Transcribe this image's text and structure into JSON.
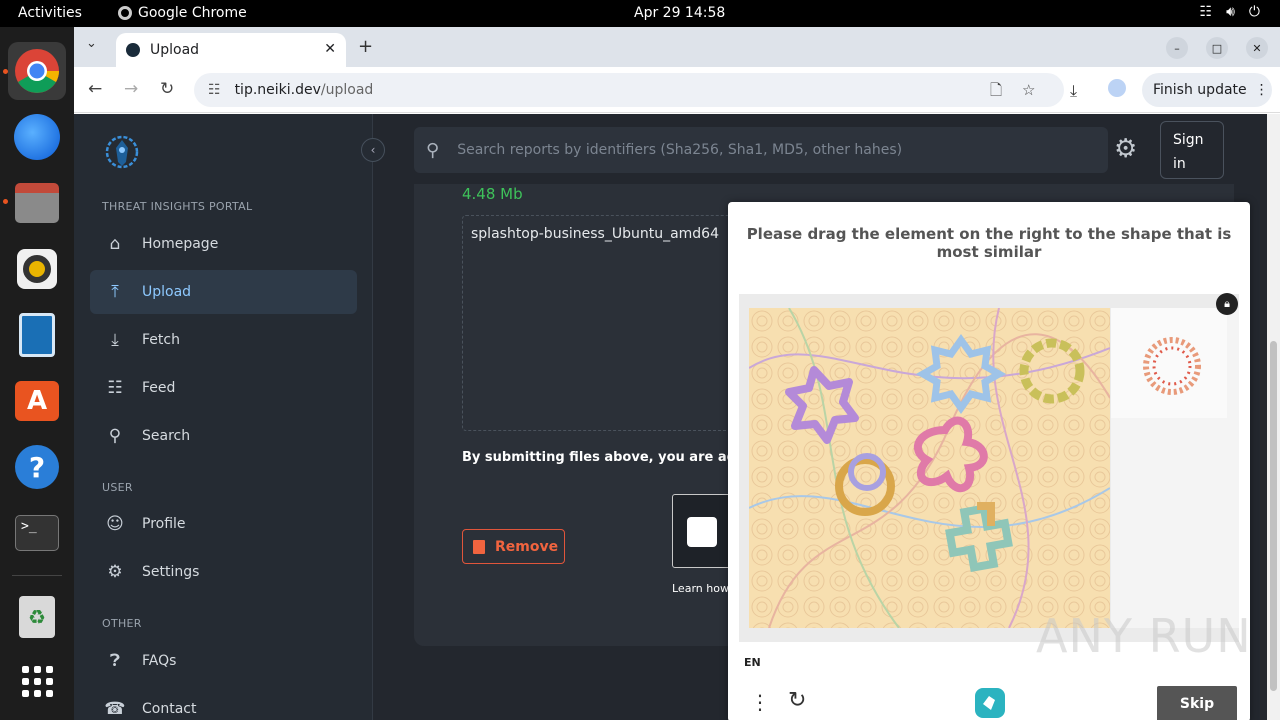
{
  "topbar": {
    "activities": "Activities",
    "app_name": "Google Chrome",
    "clock": "Apr 29  14:58"
  },
  "browser": {
    "tab_title": "Upload",
    "url_host": "tip.neiki.dev",
    "url_path": "/upload",
    "finish_update": "Finish update"
  },
  "sidebar": {
    "sections": [
      "THREAT INSIGHTS PORTAL",
      "USER",
      "OTHER"
    ],
    "items": [
      {
        "label": "Homepage",
        "icon": "home-icon"
      },
      {
        "label": "Upload",
        "icon": "upload-icon"
      },
      {
        "label": "Fetch",
        "icon": "fetch-icon"
      },
      {
        "label": "Feed",
        "icon": "feed-icon"
      },
      {
        "label": "Search",
        "icon": "search-icon"
      },
      {
        "label": "Profile",
        "icon": "profile-icon"
      },
      {
        "label": "Settings",
        "icon": "gear-icon"
      },
      {
        "label": "FAQs",
        "icon": "faq-icon"
      },
      {
        "label": "Contact",
        "icon": "contact-icon"
      }
    ]
  },
  "header": {
    "search_placeholder": "Search reports by identifiers (Sha256, Sha1, MD5, other hahes)",
    "sign_in": "Sign in"
  },
  "upload": {
    "file_size": "4.48 Mb",
    "file_name": "splashtop-business_Ubuntu_amd64",
    "agree_text": "By submitting files above, you are agreeing",
    "remove_label": "Remove",
    "learn_text": "Learn how"
  },
  "captcha": {
    "prompt": "Please drag the element on the right to the shape that is most similar",
    "language": "EN",
    "skip_label": "Skip"
  },
  "watermark": "ANY RUN"
}
